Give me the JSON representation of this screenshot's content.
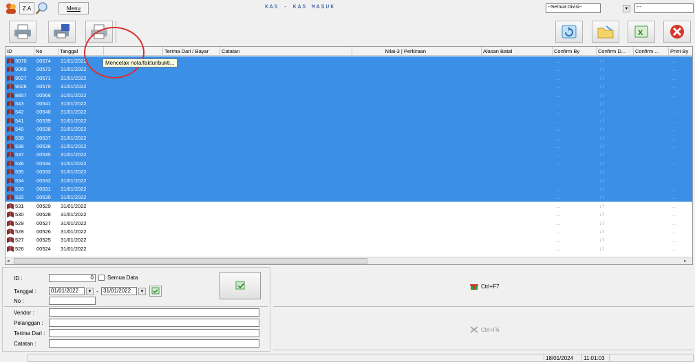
{
  "topbar": {
    "za_label": "Z.A",
    "menu_label": "Menu",
    "title": "KAS - KAS MASUK",
    "divisi_value": "--Semua Divisi--",
    "second_value": "---"
  },
  "tooltip": "Mencetak nota/faktur/bukti...",
  "grid": {
    "headers": [
      "ID",
      "No",
      "Tanggal",
      "",
      "Terima Dari / Bayar",
      "Catatan",
      "Nilai-3 | Perkiraan",
      "Alasan Batal",
      "Confirm By",
      "Confirm D...",
      "Confirm ...",
      "Print By"
    ],
    "rows": [
      {
        "id": "9070",
        "no": "00574",
        "tanggal": "31/01/2022",
        "selected": true
      },
      {
        "id": "9069",
        "no": "00573",
        "tanggal": "31/01/2022",
        "selected": true
      },
      {
        "id": "9027",
        "no": "00571",
        "tanggal": "31/01/2022",
        "selected": true
      },
      {
        "id": "9026",
        "no": "00570",
        "tanggal": "31/01/2022",
        "selected": true
      },
      {
        "id": "8857",
        "no": "00566",
        "tanggal": "31/01/2022",
        "selected": true
      },
      {
        "id": "543",
        "no": "00541",
        "tanggal": "31/01/2022",
        "selected": true
      },
      {
        "id": "542",
        "no": "00540",
        "tanggal": "31/01/2022",
        "selected": true
      },
      {
        "id": "541",
        "no": "00539",
        "tanggal": "31/01/2022",
        "selected": true
      },
      {
        "id": "540",
        "no": "00538",
        "tanggal": "31/01/2022",
        "selected": true
      },
      {
        "id": "539",
        "no": "00537",
        "tanggal": "31/01/2022",
        "selected": true
      },
      {
        "id": "538",
        "no": "00536",
        "tanggal": "31/01/2022",
        "selected": true
      },
      {
        "id": "537",
        "no": "00535",
        "tanggal": "31/01/2022",
        "selected": true
      },
      {
        "id": "536",
        "no": "00534",
        "tanggal": "31/01/2022",
        "selected": true
      },
      {
        "id": "535",
        "no": "00533",
        "tanggal": "31/01/2022",
        "selected": true
      },
      {
        "id": "534",
        "no": "00532",
        "tanggal": "31/01/2022",
        "selected": true
      },
      {
        "id": "533",
        "no": "00531",
        "tanggal": "31/01/2022",
        "selected": true
      },
      {
        "id": "532",
        "no": "00530",
        "tanggal": "31/01/2022",
        "selected": true
      },
      {
        "id": "531",
        "no": "00529",
        "tanggal": "31/01/2022",
        "selected": false
      },
      {
        "id": "530",
        "no": "00528",
        "tanggal": "31/01/2022",
        "selected": false
      },
      {
        "id": "529",
        "no": "00527",
        "tanggal": "31/01/2022",
        "selected": false
      },
      {
        "id": "528",
        "no": "00526",
        "tanggal": "31/01/2022",
        "selected": false
      },
      {
        "id": "527",
        "no": "00525",
        "tanggal": "31/01/2022",
        "selected": false
      },
      {
        "id": "526",
        "no": "00524",
        "tanggal": "31/01/2022",
        "selected": false
      }
    ],
    "confirm_by_placeholder": "...",
    "confirm_date_placeholder": "/ /",
    "print_by_placeholder": "..."
  },
  "filter": {
    "id_label": "ID :",
    "id_value": "0",
    "semua_data_label": "Semua Data",
    "tanggal_label": "Tanggal :",
    "date_from": "01/01/2022",
    "date_sep": "-",
    "date_to": "31/01/2022",
    "no_label": "No :",
    "vendor_label": "Vendor :",
    "pelanggan_label": "Pelanggan :",
    "terima_dari_label": "Terima Dari :",
    "catatan_label": "Catatan :"
  },
  "shortcuts": {
    "first": "Ctrl+F7",
    "second": "Ctrl+F6"
  },
  "statusbar": {
    "date": "18/01/2024",
    "time": "11:01:03"
  },
  "colors": {
    "selection": "#3b8fe6",
    "title": "#1a3f9a",
    "annotation_circle": "#d8302f"
  }
}
